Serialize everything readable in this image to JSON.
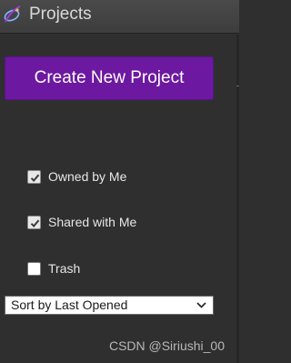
{
  "header": {
    "title": "Projects",
    "logo_icon": "ring-swoosh-logo"
  },
  "create_button": {
    "label": "Create New Project",
    "color": "#6d18a0"
  },
  "filters": [
    {
      "label": "Owned by Me",
      "checked": true
    },
    {
      "label": "Shared with Me",
      "checked": true
    },
    {
      "label": "Trash",
      "checked": false
    }
  ],
  "sort": {
    "selected": "Sort by Last Opened",
    "icon": "chevron-down-icon"
  },
  "watermark": {
    "text": "CSDN @Siriushi_00"
  }
}
